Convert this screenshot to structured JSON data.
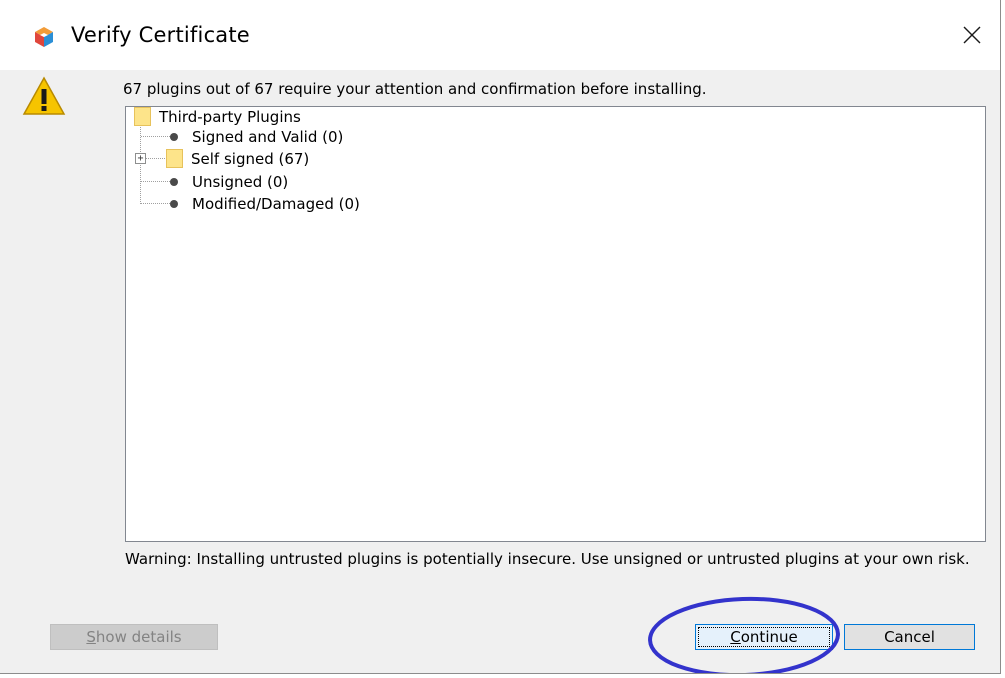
{
  "window": {
    "title": "Verify Certificate"
  },
  "message": "67 plugins out of 67 require your attention and confirmation before installing.",
  "tree": {
    "root": "Third-party Plugins",
    "children": [
      {
        "label": "Signed and Valid (0)",
        "type": "leaf"
      },
      {
        "label": "Self signed (67)",
        "type": "folder",
        "expanded": false
      },
      {
        "label": "Unsigned (0)",
        "type": "leaf"
      },
      {
        "label": "Modified/Damaged (0)",
        "type": "leaf"
      }
    ]
  },
  "warning": "Warning: Installing untrusted plugins is potentially insecure. Use unsigned or untrusted plugins at your own risk.",
  "buttons": {
    "show_details_prefix": "S",
    "show_details_rest": "how details",
    "continue_prefix": "C",
    "continue_rest": "ontinue",
    "cancel": "Cancel"
  },
  "icons": {
    "app": "netbeans-cube-icon",
    "close": "close-icon",
    "warning": "warning-triangle-icon",
    "folder": "folder-icon",
    "expander": "plus-expander-icon"
  },
  "colors": {
    "annotation": "#3333cc",
    "focus_border": "#0078d7",
    "folder": "#fde48a"
  }
}
